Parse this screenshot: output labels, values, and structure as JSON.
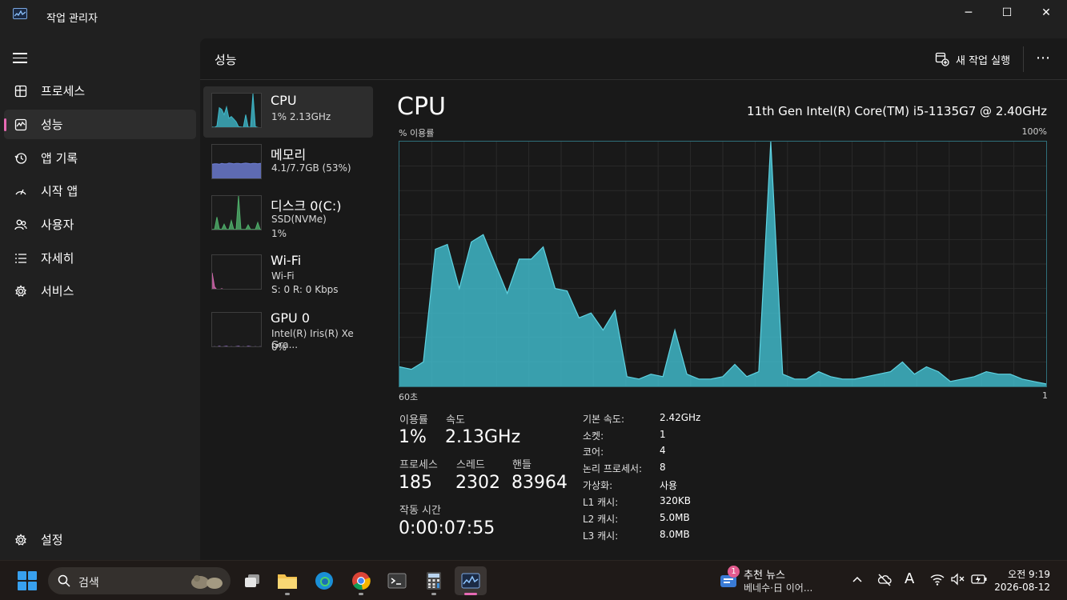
{
  "window": {
    "title": "작업 관리자",
    "controls": {
      "minimize": "─",
      "maximize": "☐",
      "close": "✕"
    }
  },
  "sidebar": {
    "items": [
      {
        "id": "processes",
        "label": "프로세스",
        "icon": "processes-icon"
      },
      {
        "id": "performance",
        "label": "성능",
        "icon": "performance-icon",
        "active": true
      },
      {
        "id": "app-history",
        "label": "앱 기록",
        "icon": "history-icon"
      },
      {
        "id": "startup",
        "label": "시작 앱",
        "icon": "startup-icon"
      },
      {
        "id": "users",
        "label": "사용자",
        "icon": "users-icon"
      },
      {
        "id": "details",
        "label": "자세히",
        "icon": "details-icon"
      },
      {
        "id": "services",
        "label": "서비스",
        "icon": "services-icon"
      }
    ],
    "settings_label": "설정"
  },
  "header": {
    "title": "성능",
    "run_task_label": "새 작업 실행",
    "more_label": "⋯"
  },
  "devices": [
    {
      "name": "CPU",
      "sub1": "1% 2.13GHz",
      "sub2": "",
      "color": "#3fb7c8"
    },
    {
      "name": "메모리",
      "sub1": "4.1/7.7GB (53%)",
      "sub2": "",
      "color": "#6f7fd8"
    },
    {
      "name": "디스크 0(C:)",
      "sub1": "SSD(NVMe)",
      "sub2": "1%",
      "color": "#4fae6a"
    },
    {
      "name": "Wi-Fi",
      "sub1": "Wi-Fi",
      "sub2": "S: 0 R: 0 Kbps",
      "color": "#d468b0"
    },
    {
      "name": "GPU 0",
      "sub1": "Intel(R) Iris(R) Xe Gra...",
      "sub2": "0%",
      "color": "#9b6fd8"
    }
  ],
  "detail": {
    "title": "CPU",
    "model": "11th Gen Intel(R) Core(TM) i5-1135G7 @ 2.40GHz",
    "y_label": "% 이용률",
    "y_max_label": "100%",
    "x_left_label": "60초",
    "x_right_label": "1",
    "stats": {
      "utilization_label": "이용률",
      "utilization": "1%",
      "speed_label": "속도",
      "speed": "2.13GHz",
      "processes_label": "프로세스",
      "processes": "185",
      "threads_label": "스레드",
      "threads": "2302",
      "handles_label": "핸들",
      "handles": "83964",
      "uptime_label": "작동 시간",
      "uptime": "0:00:07:55"
    },
    "specs": [
      {
        "k": "기본 속도:",
        "v": "2.42GHz"
      },
      {
        "k": "소켓:",
        "v": "1"
      },
      {
        "k": "코어:",
        "v": "4"
      },
      {
        "k": "논리 프로세서:",
        "v": "8"
      },
      {
        "k": "가상화:",
        "v": "사용"
      },
      {
        "k": "L1 캐시:",
        "v": "320KB"
      },
      {
        "k": "L2 캐시:",
        "v": "5.0MB"
      },
      {
        "k": "L3 캐시:",
        "v": "8.0MB"
      }
    ]
  },
  "chart_data": {
    "type": "area",
    "title": "CPU",
    "ylabel": "% 이용률",
    "ylim": [
      0,
      100
    ],
    "x_labels": [
      "60초",
      "1"
    ],
    "grid": true,
    "color": "#3fb7c8",
    "values": [
      8,
      7,
      10,
      56,
      58,
      40,
      59,
      62,
      50,
      38,
      52,
      52,
      57,
      40,
      39,
      28,
      30,
      23,
      31,
      4,
      3,
      5,
      4,
      23,
      5,
      3,
      3,
      4,
      9,
      4,
      6,
      100,
      5,
      3,
      3,
      6,
      4,
      3,
      3,
      4,
      5,
      6,
      10,
      5,
      8,
      6,
      2,
      3,
      4,
      6,
      5,
      5,
      3,
      2,
      1
    ]
  },
  "taskbar": {
    "search_label": "검색",
    "news_badge": "1",
    "news_title": "추천 뉴스",
    "news_sub": "베네수·日 이어...",
    "clock_time": "오전 9:19",
    "clock_date": "2026-08-12",
    "input_indicator": "A"
  }
}
